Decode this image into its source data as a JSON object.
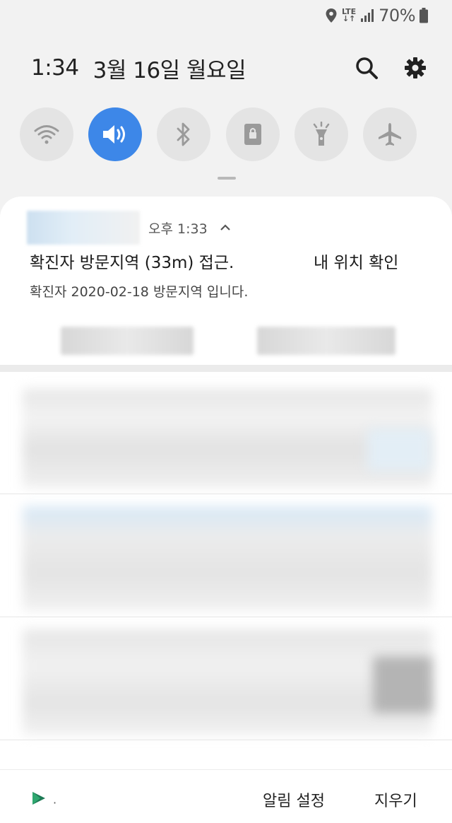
{
  "status_bar": {
    "network": "LTE",
    "battery": "70%"
  },
  "header": {
    "time": "1:34",
    "date": "3월 16일 월요일"
  },
  "quick_settings": [
    {
      "name": "wifi",
      "icon": "wifi-icon",
      "active": false
    },
    {
      "name": "sound",
      "icon": "sound-icon",
      "active": true
    },
    {
      "name": "bluetooth",
      "icon": "bluetooth-icon",
      "active": false
    },
    {
      "name": "portrait",
      "icon": "rotation-lock-icon",
      "active": false
    },
    {
      "name": "flashlight",
      "icon": "flashlight-icon",
      "active": false
    },
    {
      "name": "airplane",
      "icon": "airplane-icon",
      "active": false
    }
  ],
  "notification": {
    "time": "오후 1:33",
    "title": "확진자 방문지역 (33m) 접근.",
    "action": "내 위치 확인",
    "body": "확진자 2020-02-18 방문지역 입니다."
  },
  "bottom": {
    "settings_label": "알림 설정",
    "clear_label": "지우기",
    "dot": "·"
  },
  "colors": {
    "accent": "#3d87e8",
    "tile_inactive": "#e4e4e4",
    "play_green": "#1d7a55"
  }
}
